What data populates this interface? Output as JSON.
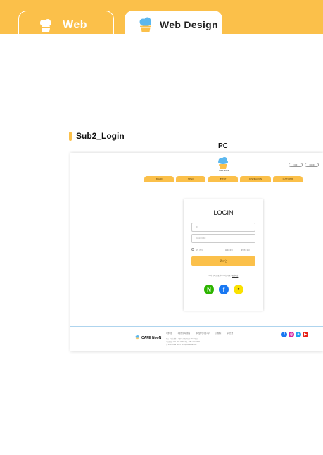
{
  "tabs": [
    {
      "label": "Web",
      "icon": "cloud-cake-icon",
      "active": false
    },
    {
      "label": "Web Design",
      "icon": "cloud-cake-icon",
      "active": true
    }
  ],
  "colors": {
    "accent": "#fbc04a",
    "cloud": "#5bb7ee",
    "naver": "#2db400",
    "facebook": "#1877f2",
    "kakao": "#fae100",
    "footer_line": "#aed4ee"
  },
  "section": {
    "title": "Sub2_Login",
    "device_label": "PC"
  },
  "mock": {
    "header": {
      "logo_text": "CAFE NooN",
      "buttons": [
        "JOIN",
        "LOGIN"
      ],
      "nav": [
        "BRAND",
        "MENU",
        "EVENT",
        "RESERVATION",
        "CUSTOMER"
      ]
    },
    "login": {
      "title": "LOGIN",
      "id_placeholder": "ID",
      "pw_placeholder": "PASSWORD",
      "keep_label": "자동 로그인",
      "find_id": "아이디찾기",
      "find_pw": "비밀번호찾기",
      "submit": "로그인",
      "signup_prompt": "아직 카페눈 회원이 아니신가요?",
      "signup_link": "회원가입",
      "social": [
        {
          "name": "naver",
          "glyph": "N"
        },
        {
          "name": "facebook",
          "glyph": "f"
        },
        {
          "name": "kakao",
          "glyph": "●"
        }
      ]
    },
    "footer": {
      "logo_text": "CAFE NooN",
      "links": [
        "이용약관",
        "개인정보처리방침",
        "이메일무단수집거부",
        "고객센터",
        "사이트맵"
      ],
      "info": [
        "주소 : 부산광역시 해운대구 해운대로 123 (우동)",
        "대표전화 : 051-000-0000  팩스 : 051-000-0000",
        "ⓒ 2023 Cafe Noon. All Rights Reserved."
      ],
      "sns": [
        "facebook-icon",
        "instagram-icon",
        "twitter-icon",
        "youtube-icon"
      ]
    }
  }
}
